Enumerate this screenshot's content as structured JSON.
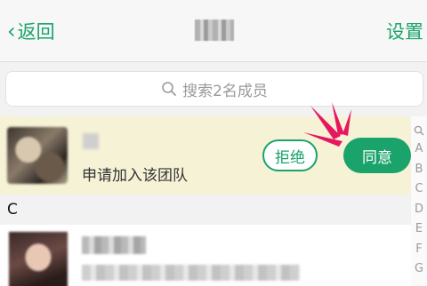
{
  "header": {
    "back_label": "返回",
    "settings_label": "设置"
  },
  "search": {
    "placeholder": "搜索2名成员"
  },
  "request": {
    "description": "申请加入该团队",
    "reject_label": "拒绝",
    "accept_label": "同意"
  },
  "members": {
    "section_letter": "C"
  },
  "index_bar": {
    "letters": [
      "A",
      "B",
      "C",
      "D",
      "E",
      "F",
      "G"
    ]
  },
  "colors": {
    "accent": "#1aa36b",
    "request_bg": "#f6f2d6",
    "annotation": "#e8175d"
  },
  "icons": [
    "back-chevron-icon",
    "search-icon",
    "index-search-icon",
    "annotation-sparkle-icon"
  ]
}
